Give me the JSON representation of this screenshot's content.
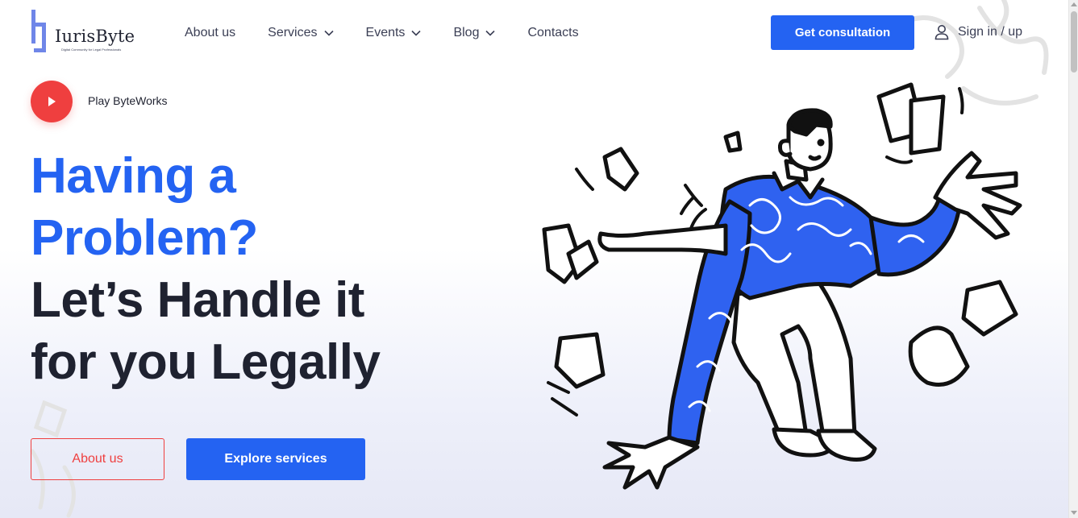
{
  "brand": {
    "name": "IurisByte",
    "tagline": "Digital Community for Legal Professionals"
  },
  "nav": {
    "items": [
      {
        "label": "About us",
        "has_dropdown": false
      },
      {
        "label": "Services",
        "has_dropdown": true
      },
      {
        "label": "Events",
        "has_dropdown": true
      },
      {
        "label": "Blog",
        "has_dropdown": true
      },
      {
        "label": "Contacts",
        "has_dropdown": false
      }
    ]
  },
  "header": {
    "cta_label": "Get consultation",
    "signin_label": "Sign in / up",
    "signin_icon": "user-icon"
  },
  "hero": {
    "play_label": "Play ByteWorks",
    "play_icon": "play-icon",
    "headline_blue_1": "Having a",
    "headline_blue_2": "Problem?",
    "headline_dark_1": "Let’s Handle it",
    "headline_dark_2": "for you Legally",
    "secondary_button": "About us",
    "primary_button": "Explore services",
    "illustration": "juggling-papers-man-illustration"
  },
  "colors": {
    "accent_blue": "#2463f2",
    "accent_red": "#ef3f3f",
    "text_dark": "#1f2230"
  }
}
